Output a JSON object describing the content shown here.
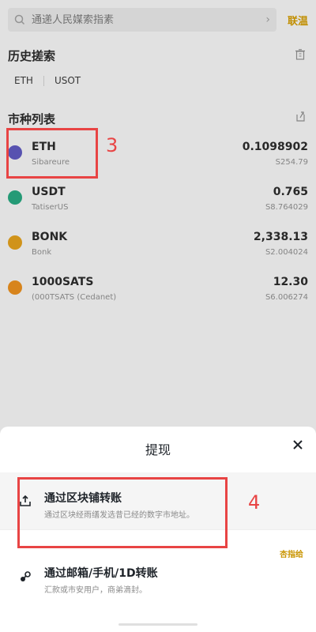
{
  "search": {
    "placeholder": "通递人民媒索指素",
    "cancel_label": "联温"
  },
  "history": {
    "title": "历史搓索",
    "tags": [
      "ETH",
      "USOT"
    ]
  },
  "market": {
    "title": "市种列表",
    "coins": [
      {
        "name": "ETH",
        "subtitle": "Sibareure",
        "price": "0.1098902",
        "usd": "S254.79",
        "icon": "eth-icon",
        "icon_color": "#5b56b8"
      },
      {
        "name": "USDT",
        "subtitle": "TatiserUS",
        "price": "0.765",
        "usd": "S8.764029",
        "icon": "usdt-icon",
        "icon_color": "#26a17b"
      },
      {
        "name": "BONK",
        "subtitle": "Bonk",
        "price": "2,338.13",
        "usd": "S2.004024",
        "icon": "bonk-icon",
        "icon_color": "#d99a1c"
      },
      {
        "name": "1000SATS",
        "subtitle": "(000TSATS (Cedanet)",
        "price": "12.30",
        "usd": "S6.006274",
        "icon": "sats-icon",
        "icon_color": "#e08a1e"
      }
    ]
  },
  "annotations": {
    "label_3": "3",
    "label_4": "4"
  },
  "sheet": {
    "title": "提现",
    "options": [
      {
        "title": "通过区块铺转账",
        "desc": "通过区块经雨缮发选昔已经的数字市地址。"
      },
      {
        "title": "通过邮箱/手机/1D转账",
        "desc": "汇款或市安用户，商弟滴封。"
      }
    ],
    "recommend_label": "杏指给"
  },
  "colors": {
    "accent": "#c99400",
    "annotation": "#e84444"
  }
}
